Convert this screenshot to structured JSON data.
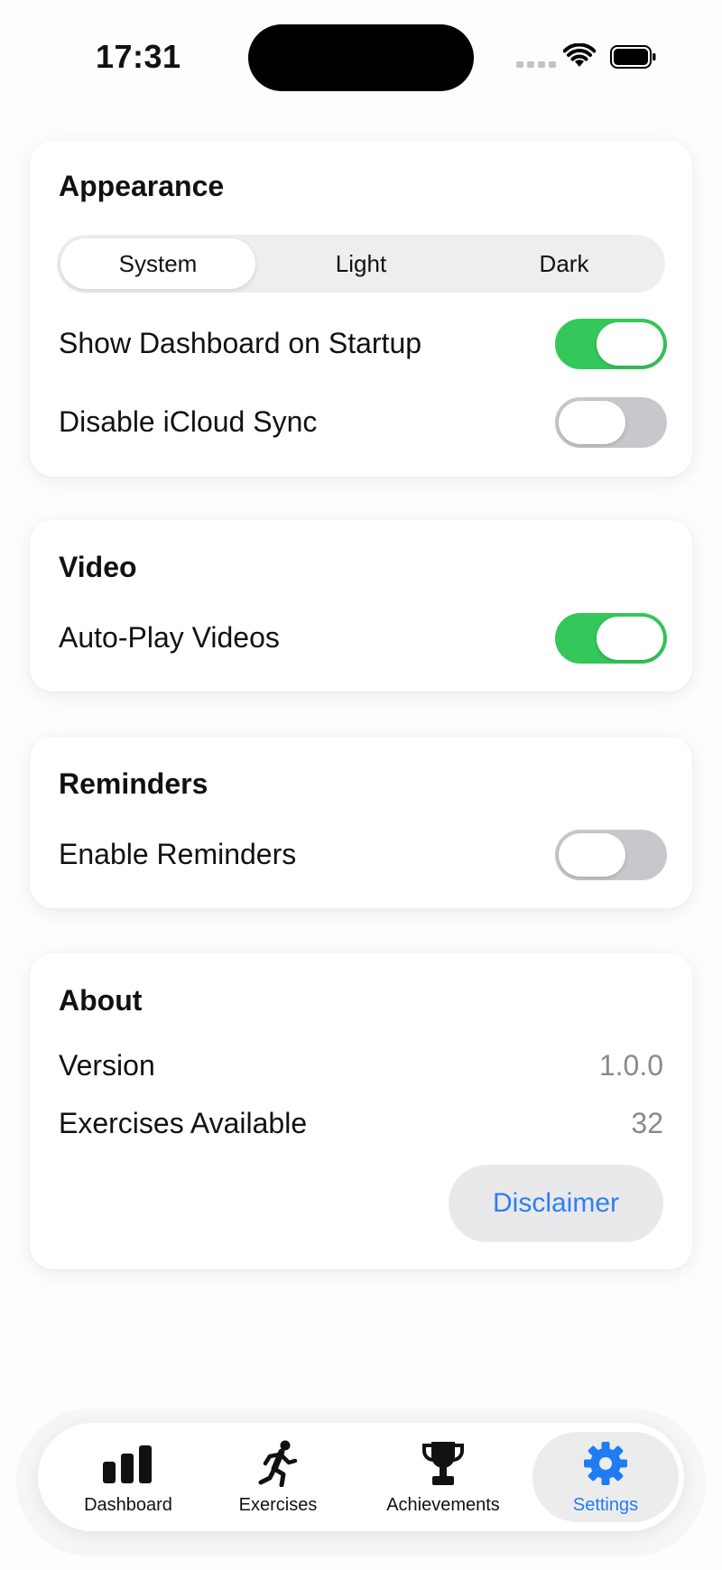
{
  "status_bar": {
    "time": "17:31"
  },
  "appearance": {
    "title": "Appearance",
    "segments": [
      "System",
      "Light",
      "Dark"
    ],
    "selected_segment": "System",
    "show_dashboard_label": "Show Dashboard on Startup",
    "show_dashboard_on": true,
    "disable_icloud_label": "Disable iCloud Sync",
    "disable_icloud_on": false
  },
  "video": {
    "title": "Video",
    "autoplay_label": "Auto-Play Videos",
    "autoplay_on": true
  },
  "reminders": {
    "title": "Reminders",
    "enable_label": "Enable Reminders",
    "enable_on": false
  },
  "about": {
    "title": "About",
    "version_label": "Version",
    "version_value": "1.0.0",
    "exercises_label": "Exercises Available",
    "exercises_value": "32",
    "disclaimer_label": "Disclaimer"
  },
  "tabbar": {
    "items": [
      {
        "label": "Dashboard",
        "icon": "bar-chart-icon",
        "active": false
      },
      {
        "label": "Exercises",
        "icon": "running-figure-icon",
        "active": false
      },
      {
        "label": "Achievements",
        "icon": "trophy-icon",
        "active": false
      },
      {
        "label": "Settings",
        "icon": "gear-icon",
        "active": true
      }
    ]
  },
  "colors": {
    "accent": "#1f7cf2",
    "toggle_on": "#34c759",
    "toggle_off": "#c7c7cc"
  }
}
